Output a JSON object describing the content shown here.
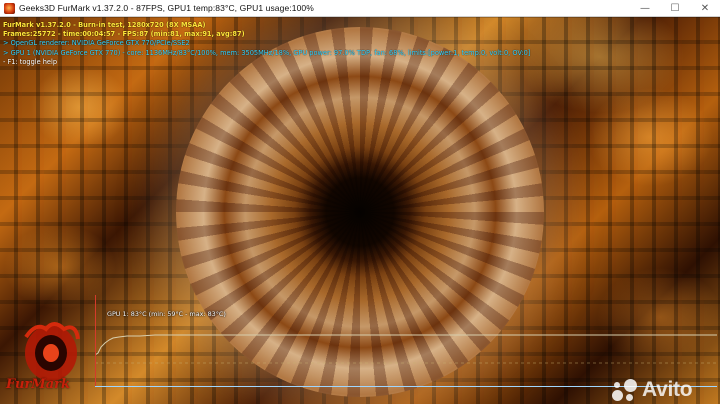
{
  "window": {
    "title": "Geeks3D FurMark v1.37.2.0 - 87FPS, GPU1 temp:83°C, GPU1 usage:100%",
    "controls": {
      "minimize": "—",
      "maximize": "☐",
      "close": "✕"
    }
  },
  "osd": {
    "line1": "FurMark v1.37.2.0 - Burn-in test, 1280x720 (8X MSAA)",
    "line2": "Frames:25772 - time:00:04:57 - FPS:87 (min:81, max:91, avg:87)",
    "line3": "> OpenGL renderer: NVIDIA GeForce GTX 770/PCIe/SSE2",
    "line4": "> GPU 1 (NVIDIA GeForce GTX 770) - core: 1136MHz/83°C/100%, mem: 3505MHz/18%, GPU power: 97.0% TDP, fan: 68%, limits:[power:1, temp:0, volt:0, OV:0]",
    "line5": "- F1: toggle help"
  },
  "graph": {
    "label": "GPU 1: 83°C (min: 59°C - max: 83°C)",
    "line_color": "#d8cfae",
    "dash_color": "#c8b070"
  },
  "logo": {
    "text": "FurMark"
  },
  "watermark": {
    "text": "Avito"
  },
  "colors": {
    "osd_yellow": "#ffe73a",
    "osd_cyan": "#35d4ff",
    "osd_white": "#ffffff",
    "axis_red": "#d43b2b"
  }
}
